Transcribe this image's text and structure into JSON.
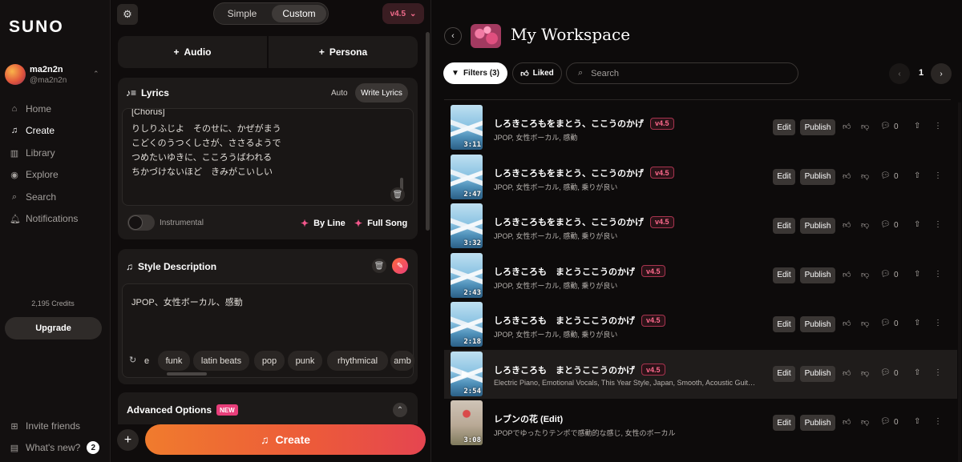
{
  "sidebar": {
    "logo": "SUNO",
    "user": {
      "name": "ma2n2n",
      "handle": "@ma2n2n"
    },
    "nav": [
      {
        "label": "Home",
        "icon": "home-icon",
        "glyph": "⌂"
      },
      {
        "label": "Create",
        "icon": "music-note-icon",
        "glyph": "♫"
      },
      {
        "label": "Library",
        "icon": "library-icon",
        "glyph": "▥"
      },
      {
        "label": "Explore",
        "icon": "compass-icon",
        "glyph": "◉"
      },
      {
        "label": "Search",
        "icon": "search-icon",
        "glyph": "⌕"
      },
      {
        "label": "Notifications",
        "icon": "bell-icon",
        "glyph": "🔔︎"
      }
    ],
    "credits": "2,195 Credits",
    "upgrade": "Upgrade",
    "invite": "Invite friends",
    "whats_new": "What's new?",
    "whats_new_count": "2"
  },
  "create": {
    "mode_simple": "Simple",
    "mode_custom": "Custom",
    "model": "v4.5",
    "audio_btn": "Audio",
    "persona_btn": "Persona",
    "lyrics": {
      "header": "Lyrics",
      "auto": "Auto",
      "write": "Write Lyrics",
      "lines": [
        "[Chorus]",
        "りしりふじよ　そのせに、かぜがまう",
        "こどくのうつくしさが、ささるようで",
        "つめたいゆきに、こころうばわれる",
        "ちかづけないほど　きみがこいしい"
      ]
    },
    "instrumental": "Instrumental",
    "by_line": "By Line",
    "full_song": "Full Song",
    "style": {
      "header": "Style Description",
      "value": "JPOP、女性ボーカル、感動",
      "tags": [
        "e",
        "funk",
        "latin beats",
        "pop",
        "punk",
        "rhythmical",
        "amb"
      ]
    },
    "advanced": "Advanced Options",
    "new_badge": "NEW",
    "create_btn": "Create"
  },
  "workspace": {
    "title": "My Workspace",
    "filters": "Filters (3)",
    "liked": "Liked",
    "search_placeholder": "Search",
    "page": "1",
    "edit": "Edit",
    "publish": "Publish",
    "songs": [
      {
        "title": "しろきころもをまとう、ここうのかげ",
        "version": "v4.5",
        "tags": "JPOP, 女性ボーカル, 感動",
        "duration": "3:11",
        "comments": "0",
        "theme": "mountain"
      },
      {
        "title": "しろきころもをまとう、ここうのかげ",
        "version": "v4.5",
        "tags": "JPOP, 女性ボーカル, 感動, 乗りが良い",
        "duration": "2:47",
        "comments": "0",
        "theme": "mountain"
      },
      {
        "title": "しろきころもをまとう、ここうのかげ",
        "version": "v4.5",
        "tags": "JPOP, 女性ボーカル, 感動, 乗りが良い",
        "duration": "3:32",
        "comments": "0",
        "theme": "mountain"
      },
      {
        "title": "しろきころも　まとうここうのかげ",
        "version": "v4.5",
        "tags": "JPOP, 女性ボーカル, 感動, 乗りが良い",
        "duration": "2:43",
        "comments": "0",
        "theme": "mountain"
      },
      {
        "title": "しろきころも　まとうここうのかげ",
        "version": "v4.5",
        "tags": "JPOP, 女性ボーカル, 感動, 乗りが良い",
        "duration": "2:18",
        "comments": "0",
        "theme": "mountain"
      },
      {
        "title": "しろきころも　まとうここうのかげ",
        "version": "v4.5",
        "tags": "Electric Piano, Emotional Vocals, This Year Style, Japan, Smooth, Acoustic Guitar, Cello, V...",
        "duration": "2:54",
        "comments": "0",
        "theme": "mountain",
        "selected": true
      },
      {
        "title": "レブンの花 (Edit)",
        "version": "",
        "tags": "JPOPでゆったりテンポで感動的な感じ, 女性のボーカル",
        "duration": "3:08",
        "comments": "0",
        "theme": "flower"
      }
    ]
  }
}
